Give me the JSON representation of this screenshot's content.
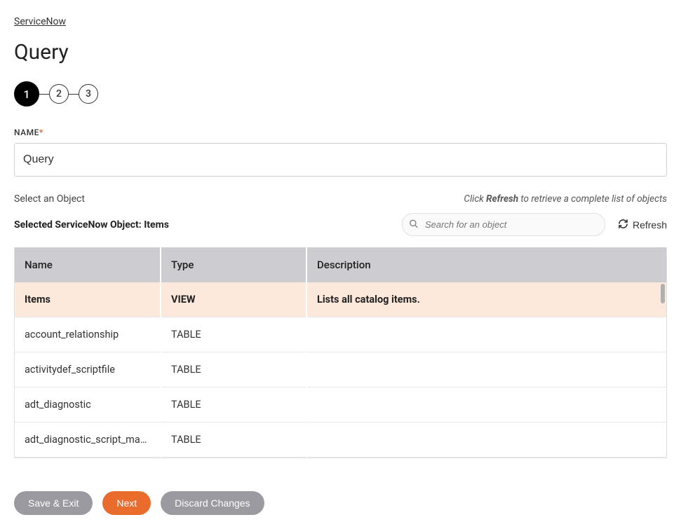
{
  "breadcrumb": "ServiceNow",
  "page_title": "Query",
  "stepper": {
    "steps": [
      "1",
      "2",
      "3"
    ],
    "active_index": 0
  },
  "name_field": {
    "label": "NAME",
    "required_mark": "*",
    "value": "Query"
  },
  "object_section": {
    "select_label": "Select an Object",
    "hint_prefix": "Click ",
    "hint_bold": "Refresh",
    "hint_suffix": " to retrieve a complete list of objects",
    "selected_label": "Selected ServiceNow Object: Items",
    "search_placeholder": "Search for an object",
    "refresh_label": "Refresh"
  },
  "table": {
    "headers": {
      "name": "Name",
      "type": "Type",
      "description": "Description"
    },
    "rows": [
      {
        "name": "Items",
        "type": "VIEW",
        "description": "Lists all catalog items.",
        "selected": true
      },
      {
        "name": "account_relationship",
        "type": "TABLE",
        "description": "",
        "selected": false
      },
      {
        "name": "activitydef_scriptfile",
        "type": "TABLE",
        "description": "",
        "selected": false
      },
      {
        "name": "adt_diagnostic",
        "type": "TABLE",
        "description": "",
        "selected": false
      },
      {
        "name": "adt_diagnostic_script_map...",
        "type": "TABLE",
        "description": "",
        "selected": false
      }
    ]
  },
  "buttons": {
    "save_exit": "Save & Exit",
    "next": "Next",
    "discard": "Discard Changes"
  }
}
